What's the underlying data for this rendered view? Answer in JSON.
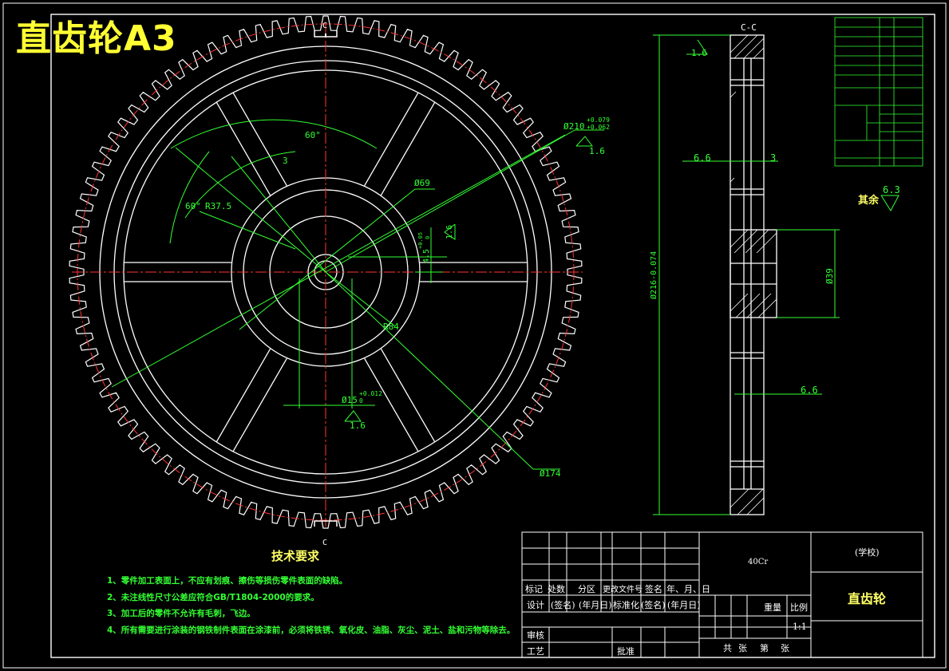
{
  "sheet_title": "直齿轮A3",
  "view_labels": {
    "section_top": "C",
    "section_bottom": "C",
    "section_view": "C-C"
  },
  "front_view": {
    "angle_top": "60°",
    "angle_left": "60°",
    "spoke_note": "3",
    "r_spoke": "R37.5",
    "d_hub_outer": "Ø69",
    "d_pitch": "Ø210",
    "d_pitch_tol_upper": "+0.079",
    "d_pitch_tol_lower": "+0.062",
    "rough_pitch": "1.6",
    "keyway": "4.5",
    "keyway_tol": "+0.05",
    "keyway_tol_lower": "0",
    "rough_keyway": "1.6",
    "r_rim": "R84",
    "d_bore": "Ø15",
    "d_bore_tol_upper": "+0.012",
    "d_bore_tol_lower": "0",
    "rough_bore": "1.6",
    "d_rim_inner": "Ø174"
  },
  "section_view": {
    "rough_top": "1.6",
    "width_a": "6.6",
    "width_b": "3",
    "d_outer": "Ø216-0.074",
    "d_hub": "Ø39",
    "width_c": "6.6",
    "rest_rough_label": "其余",
    "rest_rough_value": "6.3"
  },
  "tech_requirements": {
    "title": "技术要求",
    "items": [
      "1、零件加工表面上，不应有划痕、擦伤等损伤零件表面的缺陷。",
      "2、未注线性尺寸公差应符合GB/T1804-2000的要求。",
      "3、加工后的零件不允许有毛刺，飞边。",
      "4、所有需要进行涂装的钢铁制件表面在涂漆前，必须将铁锈、氧化皮、油脂、灰尘、泥土、盐和污物等除去。"
    ]
  },
  "title_block": {
    "material": "40Cr",
    "school": "(学校)",
    "part_name": "直齿轮",
    "row_marks": [
      "标记",
      "处数",
      "分区",
      "更改文件号",
      "签名",
      "年、月、日"
    ],
    "row_design": [
      "设计",
      "(签名)",
      "(年月日)",
      "标准化",
      "(签名)",
      "(年月日)"
    ],
    "weight": "重量",
    "scale_label": "比例",
    "scale": "1:1",
    "check": "审核",
    "process": "工艺",
    "approve": "批准",
    "sheets_total": "共",
    "sheets_unit": "张",
    "sheet_no": "第",
    "sheet_unit2": "张"
  },
  "colors": {
    "background": "#000000",
    "outline": "#ffffff",
    "dimension": "#33ff33",
    "centerline": "#ff2222",
    "title": "#ffff33"
  }
}
